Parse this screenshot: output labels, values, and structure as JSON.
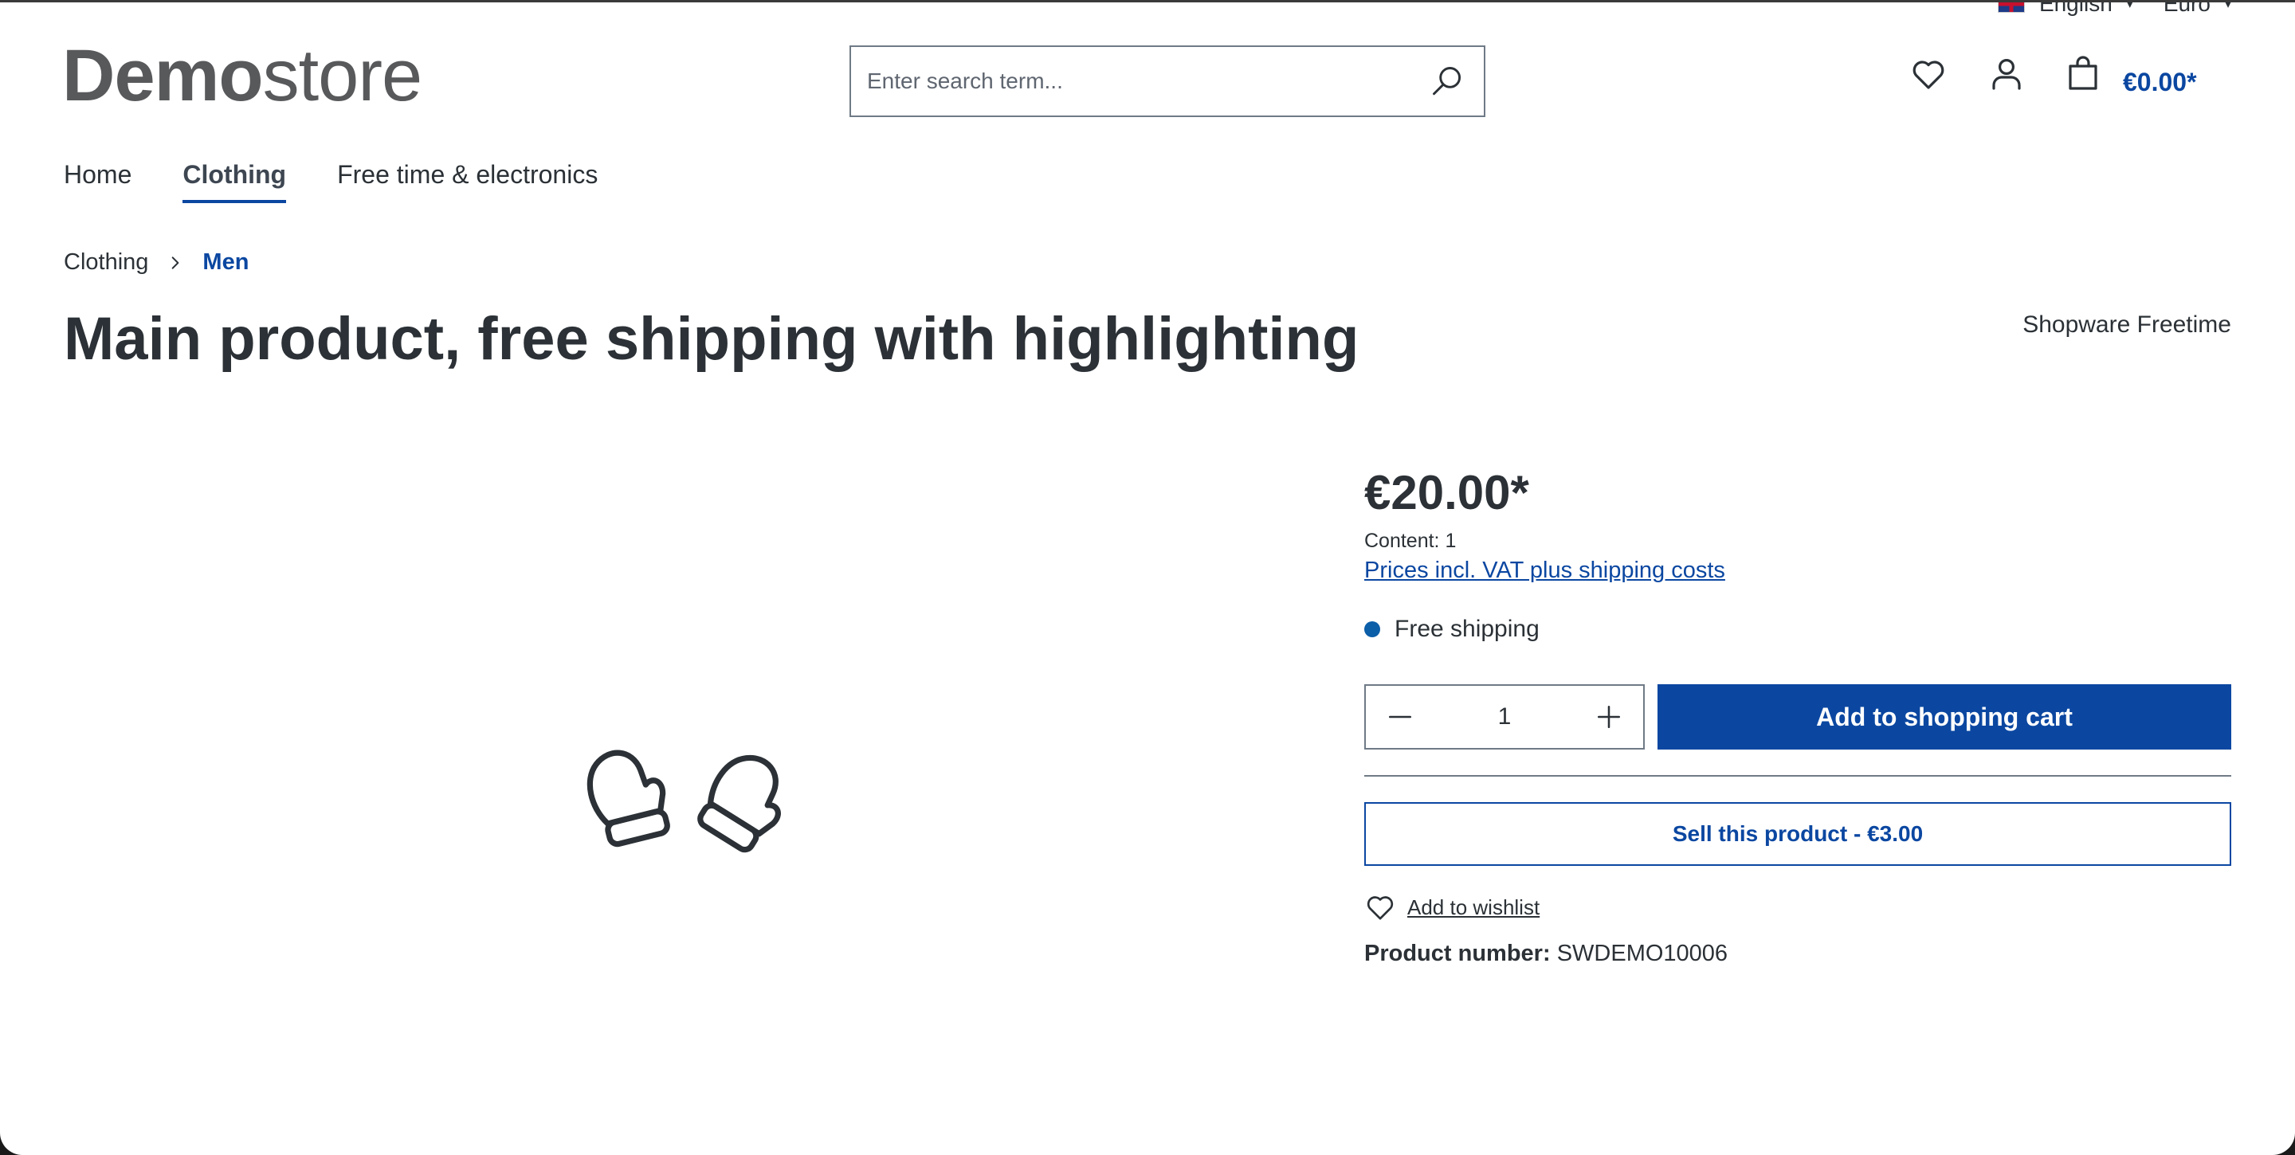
{
  "topbar": {
    "language": "English",
    "currency": "Euro"
  },
  "header": {
    "logo_bold": "Demo",
    "logo_light": "store",
    "search_placeholder": "Enter search term...",
    "cart_total": "€0.00*"
  },
  "nav": {
    "items": [
      {
        "label": "Home"
      },
      {
        "label": "Clothing"
      },
      {
        "label": "Free time & electronics"
      }
    ]
  },
  "breadcrumb": {
    "parent": "Clothing",
    "current": "Men"
  },
  "product": {
    "title": "Main product, free shipping with highlighting",
    "manufacturer": "Shopware Freetime",
    "price": "€20.00*",
    "content": "Content: 1",
    "vat_note": "Prices incl. VAT plus shipping costs",
    "delivery": "Free shipping",
    "quantity": "1",
    "add_to_cart": "Add to shopping cart",
    "sell_button": "Sell this product - €3.00",
    "wishlist": "Add to wishlist",
    "number_label": "Product number:",
    "number_value": "SWDEMO10006"
  },
  "colors": {
    "primary": "#0b47a1",
    "text": "#2b3136",
    "delivery_dot": "#0b5ea8"
  }
}
